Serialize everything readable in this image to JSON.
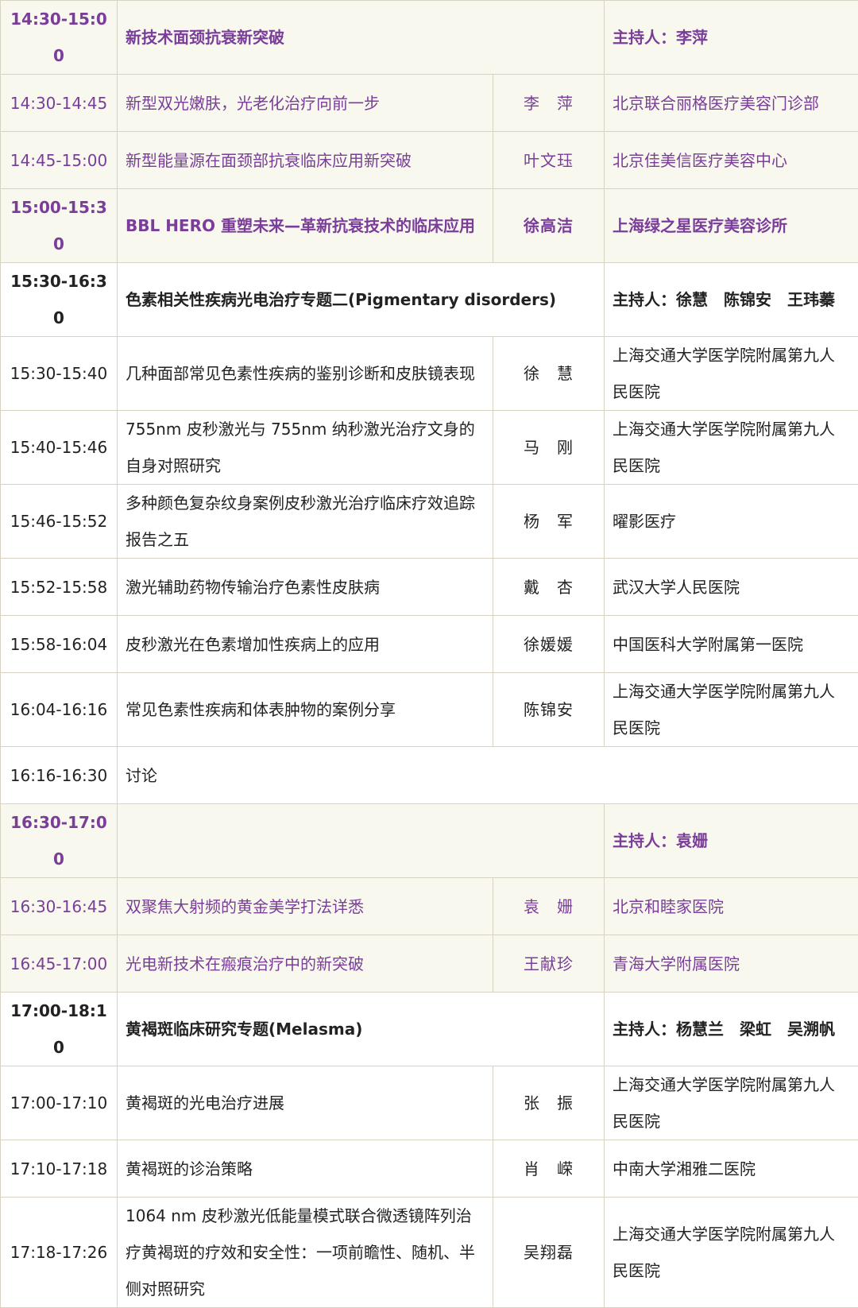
{
  "rows": [
    {
      "kind": "header",
      "style": "purple-bold-shade",
      "time": "14:30-15:00",
      "title": "新技术面颈抗衰新突破",
      "host": "主持人：李萍"
    },
    {
      "kind": "talk",
      "style": "purple-shade",
      "time": "14:30-14:45",
      "title": "新型双光嫩肤，光老化治疗向前一步",
      "speaker": "李　萍",
      "institution": "北京联合丽格医疗美容门诊部"
    },
    {
      "kind": "talk",
      "style": "purple-shade",
      "time": "14:45-15:00",
      "title": "新型能量源在面颈部抗衰临床应用新突破",
      "speaker": "叶文珏",
      "institution": "北京佳美信医疗美容中心"
    },
    {
      "kind": "talk",
      "style": "purple-bold-shade",
      "time": "15:00-15:30",
      "title": "BBL HERO 重塑未来—革新抗衰技术的临床应用",
      "speaker": "徐高洁",
      "institution": "上海绿之星医疗美容诊所"
    },
    {
      "kind": "header",
      "style": "black-bold",
      "time": "15:30-16:30",
      "title": "色素相关性疾病光电治疗专题二(Pigmentary disorders)",
      "host": "主持人：徐慧　陈锦安　王玮蓁"
    },
    {
      "kind": "talk",
      "style": "normal",
      "time": "15:30-15:40",
      "title": "几种面部常见色素性疾病的鉴别诊断和皮肤镜表现",
      "speaker": "徐　慧",
      "institution": "上海交通大学医学院附属第九人民医院"
    },
    {
      "kind": "talk",
      "style": "normal",
      "time": "15:40-15:46",
      "title": "755nm 皮秒激光与 755nm 纳秒激光治疗文身的自身对照研究",
      "speaker": "马　刚",
      "institution": "上海交通大学医学院附属第九人民医院"
    },
    {
      "kind": "talk",
      "style": "normal",
      "time": "15:46-15:52",
      "title": "多种颜色复杂纹身案例皮秒激光治疗临床疗效追踪报告之五",
      "speaker": "杨　军",
      "institution": "曜影医疗"
    },
    {
      "kind": "talk",
      "style": "normal",
      "time": "15:52-15:58",
      "title": "激光辅助药物传输治疗色素性皮肤病",
      "speaker": "戴　杏",
      "institution": "武汉大学人民医院"
    },
    {
      "kind": "talk",
      "style": "normal",
      "time": "15:58-16:04",
      "title": "皮秒激光在色素增加性疾病上的应用",
      "speaker": "徐媛媛",
      "institution": "中国医科大学附属第一医院"
    },
    {
      "kind": "talk",
      "style": "normal",
      "time": "16:04-16:16",
      "title": "常见色素性疾病和体表肿物的案例分享",
      "speaker": "陈锦安",
      "institution": "上海交通大学医学院附属第九人民医院"
    },
    {
      "kind": "discussion",
      "style": "normal",
      "time": "16:16-16:30",
      "title": "讨论"
    },
    {
      "kind": "header",
      "style": "purple-bold-shade",
      "time": "16:30-17:00",
      "title": "",
      "host": "主持人：袁姗"
    },
    {
      "kind": "talk",
      "style": "purple-shade",
      "time": "16:30-16:45",
      "title": "双聚焦大射频的黄金美学打法详悉",
      "speaker": "袁　姗",
      "institution": "北京和睦家医院"
    },
    {
      "kind": "talk",
      "style": "purple-shade",
      "time": "16:45-17:00",
      "title": "光电新技术在瘢痕治疗中的新突破",
      "speaker": "王献珍",
      "institution": "青海大学附属医院"
    },
    {
      "kind": "header",
      "style": "black-bold",
      "time": "17:00-18:10",
      "title": "黄褐斑临床研究专题(Melasma)",
      "host": "主持人：杨慧兰　梁虹　吴溯帆"
    },
    {
      "kind": "talk",
      "style": "normal",
      "time": "17:00-17:10",
      "title": "黄褐斑的光电治疗进展",
      "speaker": "张　振",
      "institution": "上海交通大学医学院附属第九人民医院"
    },
    {
      "kind": "talk",
      "style": "normal",
      "time": "17:10-17:18",
      "title": "黄褐斑的诊治策略",
      "speaker": "肖　嵘",
      "institution": "中南大学湘雅二医院"
    },
    {
      "kind": "talk",
      "style": "normal",
      "time": "17:18-17:26",
      "title": "1064 nm 皮秒激光低能量模式联合微透镜阵列治疗黄褐斑的疗效和安全性：一项前瞻性、随机、半侧对照研究",
      "speaker": "吴翔磊",
      "institution": "上海交通大学医学院附属第九人民医院"
    }
  ]
}
